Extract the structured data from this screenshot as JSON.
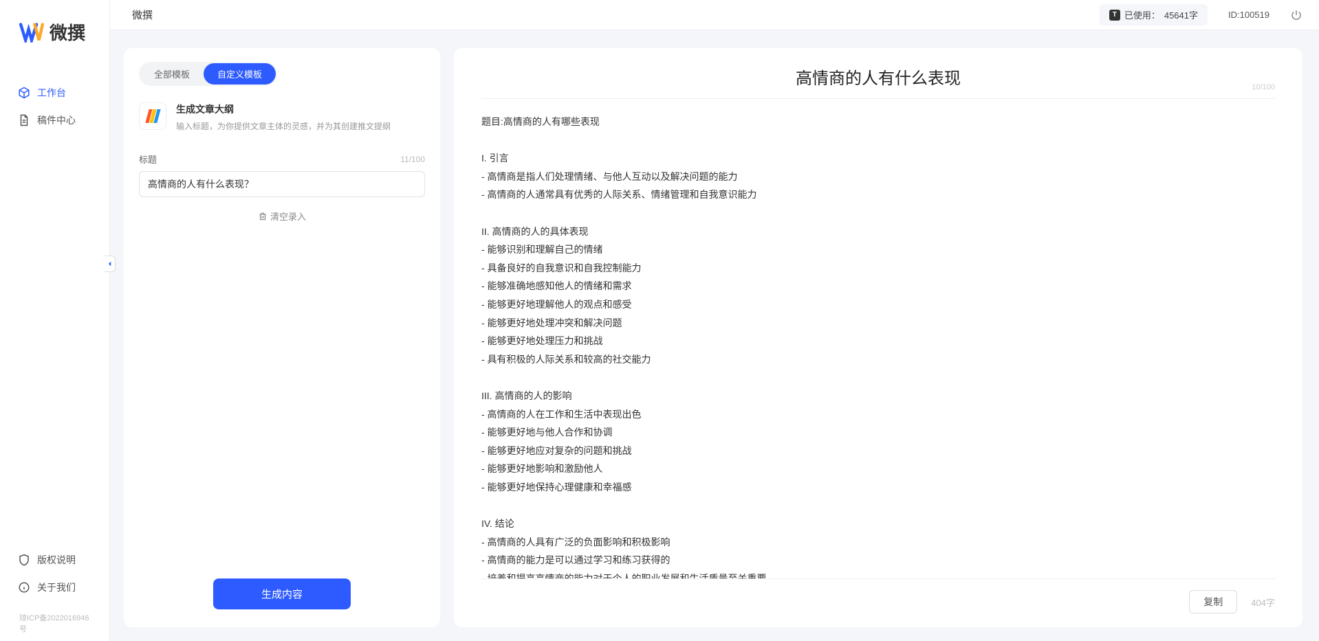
{
  "app": {
    "name": "微撰",
    "logo_letter": "W"
  },
  "sidebar": {
    "nav": [
      {
        "label": "工作台",
        "icon": "cube"
      },
      {
        "label": "稿件中心",
        "icon": "document"
      }
    ],
    "bottom": [
      {
        "label": "版权说明",
        "icon": "shield"
      },
      {
        "label": "关于我们",
        "icon": "info"
      }
    ],
    "footer": "琼ICP备2022016946号"
  },
  "topbar": {
    "title": "微撰",
    "usage_label": "已使用：",
    "usage_value": "45641字",
    "id_label": "ID:100519"
  },
  "left": {
    "tabs": [
      {
        "label": "全部模板",
        "active": false
      },
      {
        "label": "自定义模板",
        "active": true
      }
    ],
    "template": {
      "title": "生成文章大纲",
      "desc": "输入标题，为你提供文章主体的灵感，并为其创建推文提纲"
    },
    "form": {
      "label": "标题",
      "count": "11/100",
      "value": "高情商的人有什么表现？"
    },
    "clear_label": "清空录入",
    "generate_label": "生成内容"
  },
  "right": {
    "title": "高情商的人有什么表现",
    "title_count": "10/100",
    "content": "题目:高情商的人有哪些表现\n\nI. 引言\n- 高情商是指人们处理情绪、与他人互动以及解决问题的能力\n- 高情商的人通常具有优秀的人际关系、情绪管理和自我意识能力\n\nII. 高情商的人的具体表现\n- 能够识别和理解自己的情绪\n- 具备良好的自我意识和自我控制能力\n- 能够准确地感知他人的情绪和需求\n- 能够更好地理解他人的观点和感受\n- 能够更好地处理冲突和解决问题\n- 能够更好地处理压力和挑战\n- 具有积极的人际关系和较高的社交能力\n\nIII. 高情商的人的影响\n- 高情商的人在工作和生活中表现出色\n- 能够更好地与他人合作和协调\n- 能够更好地应对复杂的问题和挑战\n- 能够更好地影响和激励他人\n- 能够更好地保持心理健康和幸福感\n\nIV. 结论\n- 高情商的人具有广泛的负面影响和积极影响\n- 高情商的能力是可以通过学习和练习获得的\n- 培养和提高高情商的能力对于个人的职业发展和生活质量至关重要。",
    "copy_label": "复制",
    "word_count": "404字"
  }
}
